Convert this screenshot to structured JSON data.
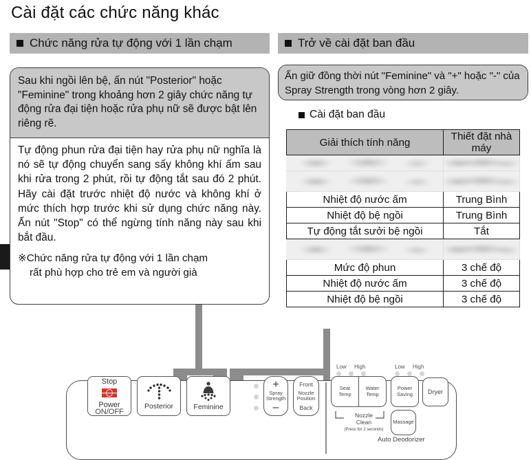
{
  "page": {
    "title": "Cài đặt các chức năng khác"
  },
  "sections": {
    "left": {
      "header": "Chức năng rửa tự động với 1 lần chạm",
      "callout": {
        "grey_text": "Sau khi ngồi lên bệ, ấn nút \"Posterior\" hoặc \"Feminine\" trong khoảng hơn 2 giây chức năng tự động rửa đại tiện hoặc rửa phụ nữ sẽ được bật lên riêng rẽ.",
        "white_text": "Tự động phun rửa đại tiện hay rửa phụ nữ nghĩa là nó sẽ tự động chuyển sang sấy không khí ấm sau khi rửa trong 2 phút, rồi tự động tắt sau đó 2 phút. Hãy cài đặt trước nhiệt độ nước và không khí ở mức thích hợp trước khi sử dụng chức năng này. Ấn nút \"Stop\" có thể ngừng tính năng này sau khi bắt đầu.",
        "note_marker": "※",
        "note_line1": "Chức năng rửa tự động với 1 lần chạm",
        "note_line2": "rất phù hợp cho trẻ em và người già"
      }
    },
    "right": {
      "header": "Trở về cài đặt ban đầu",
      "callout_text": "Ấn giữ đồng thời nút \"Feminine\" và \"+\" hoặc \"-\" của Spray Strength trong vòng hơn 2 giây.",
      "sub_header": "Cài đặt ban đầu",
      "table": {
        "columns": [
          "Giải thích tính năng",
          "Thiết đặt nhà máy"
        ],
        "rows": [
          {
            "feature": "",
            "setting": "",
            "blurred": true
          },
          {
            "feature": "",
            "setting": "",
            "blurred": true
          },
          {
            "feature": "Nhiệt độ nước ấm",
            "setting": "Trung Bình",
            "blurred": false
          },
          {
            "feature": "Nhiệt độ bệ ngồi",
            "setting": "Trung Bình",
            "blurred": false
          },
          {
            "feature": "Tự động tắt sưởi bệ ngồi",
            "setting": "Tắt",
            "blurred": false
          },
          {
            "feature": "",
            "setting": "",
            "blurred": true
          },
          {
            "feature": "Mức độ phun",
            "setting": "3 chế độ",
            "blurred": false
          },
          {
            "feature": "Nhiệt độ nước ấm",
            "setting": "3 chế độ",
            "blurred": false
          },
          {
            "feature": "Nhiệt độ bệ ngồi",
            "setting": "3 chế độ",
            "blurred": false
          }
        ]
      }
    }
  },
  "remote": {
    "stop_label": "Stop",
    "power_label": "Power",
    "power_sub": "ON/OFF",
    "posterior_label": "Posterior",
    "feminine_label": "Feminine",
    "spray_plus": "+",
    "spray_minus": "–",
    "spray_line1": "Spray",
    "spray_line2": "Strength",
    "nozzle_front": "Front",
    "nozzle_line1": "Nozzle",
    "nozzle_line2": "Position",
    "nozzle_back": "Back",
    "seat_temp_line1": "Seat",
    "seat_temp_line2": "Temp",
    "water_temp_line1": "Water",
    "water_temp_line2": "Temp",
    "power_saving_line1": "Power",
    "power_saving_line2": "Saving",
    "dryer_label": "Dryer",
    "massage_label": "Massage",
    "nozzle_clean_line1": "Nozzle",
    "nozzle_clean_line2": "Clean",
    "nozzle_clean_note": "(Press for 2 seconds)",
    "auto_deodorizer": "Auto Deodorizer",
    "led_low": "Low",
    "led_high": "High",
    "led_low2": "Low",
    "led_high2": "High"
  },
  "colors": {
    "header_bar": "#b3b3b3",
    "callout_grey": "#c8c8c8",
    "arrow_grey": "#8c8c8c",
    "power_red": "#d8322a"
  }
}
